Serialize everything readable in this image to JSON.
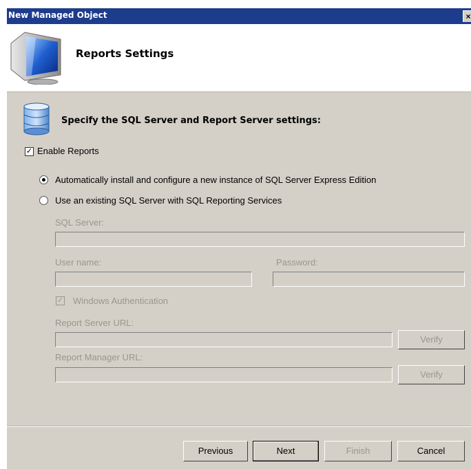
{
  "window": {
    "title": "New Managed Object",
    "close_glyph": "×"
  },
  "header": {
    "title": "Reports Settings",
    "icon": "monitor-icon"
  },
  "section": {
    "title": "Specify the SQL Server and Report Server settings:",
    "icon": "database-icon"
  },
  "enable_reports": {
    "label": "Enable Reports",
    "checked": true
  },
  "options": {
    "auto_install": {
      "label": "Automatically install and configure a new instance of SQL Server Express Edition",
      "selected": true
    },
    "existing": {
      "label": "Use an existing SQL Server with SQL Reporting Services",
      "selected": false
    }
  },
  "fields": {
    "sql_server": {
      "label": "SQL Server:",
      "value": ""
    },
    "user_name": {
      "label": "User name:",
      "value": ""
    },
    "password": {
      "label": "Password:",
      "value": ""
    },
    "windows_auth": {
      "label": "Windows Authentication",
      "checked": true
    },
    "report_server_url": {
      "label": "Report Server URL:",
      "value": "",
      "verify_label": "Verify"
    },
    "report_manager_url": {
      "label": "Report Manager URL:",
      "value": "",
      "verify_label": "Verify"
    }
  },
  "footer": {
    "previous": "Previous",
    "next": "Next",
    "finish": "Finish",
    "cancel": "Cancel"
  },
  "colors": {
    "titlebar": "#1e3c8c",
    "dialog_bg": "#d4d0c8",
    "disabled_text": "#9a968e"
  }
}
